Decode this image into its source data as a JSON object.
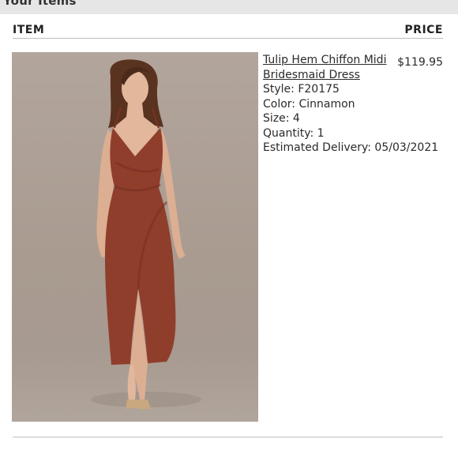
{
  "section": {
    "title": "Your Items"
  },
  "columns": {
    "item": "ITEM",
    "price": "PRICE"
  },
  "item": {
    "name": "Tulip Hem Chiffon Midi Bridesmaid Dress",
    "style": "Style: F20175",
    "color": "Color: Cinnamon",
    "size": "Size: 4",
    "quantity": "Quantity: 1",
    "delivery": "Estimated Delivery: 05/03/2021",
    "price": "$119.95"
  },
  "colors": {
    "dress": "#8f3e2c",
    "background": "#ab9e94",
    "skin": "#e2b79c",
    "hair": "#5a3320"
  }
}
